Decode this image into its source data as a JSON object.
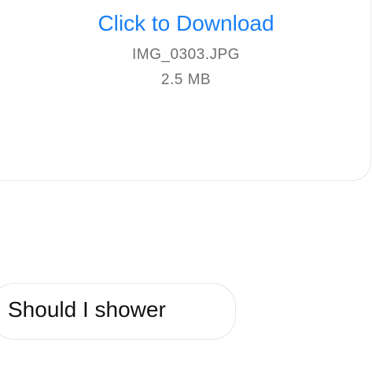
{
  "attachment": {
    "download_label": "Click to Download",
    "file_name": "IMG_0303.JPG",
    "file_size": "2.5 MB"
  },
  "message": {
    "text": "Should I shower"
  },
  "colors": {
    "link": "#1a7ff5",
    "meta_text": "#6e6e73",
    "bubble_border": "#e6e6ea"
  }
}
